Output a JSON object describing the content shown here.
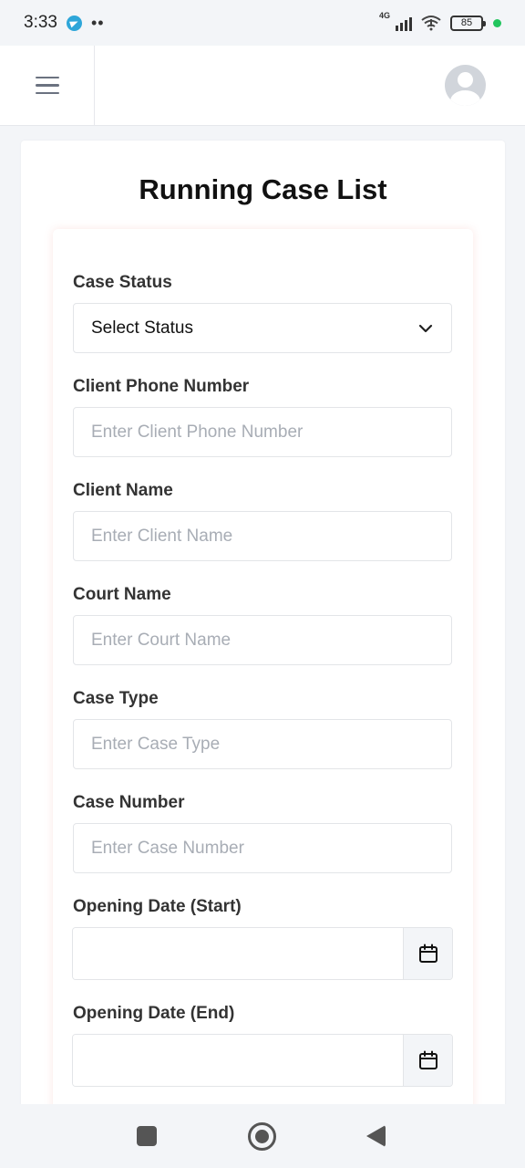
{
  "status_bar": {
    "time": "3:33",
    "network": "4G",
    "battery": "85"
  },
  "page": {
    "title": "Running Case List"
  },
  "form": {
    "case_status": {
      "label": "Case Status",
      "value": "Select Status"
    },
    "client_phone": {
      "label": "Client Phone Number",
      "placeholder": "Enter Client Phone Number"
    },
    "client_name": {
      "label": "Client Name",
      "placeholder": "Enter Client Name"
    },
    "court_name": {
      "label": "Court Name",
      "placeholder": "Enter Court Name"
    },
    "case_type": {
      "label": "Case Type",
      "placeholder": "Enter Case Type"
    },
    "case_number": {
      "label": "Case Number",
      "placeholder": "Enter Case Number"
    },
    "opening_date_start": {
      "label": "Opening Date (Start)",
      "value": ""
    },
    "opening_date_end": {
      "label": "Opening Date (End)",
      "value": ""
    }
  },
  "colors": {
    "accent_shadow": "#ef786e",
    "online": "#22c55e",
    "telegram": "#2ea6d9"
  },
  "icons": [
    "telegram-icon",
    "signal-icon",
    "wifi-icon",
    "battery-icon",
    "menu-icon",
    "avatar-icon",
    "chevron-down-icon",
    "calendar-icon",
    "nav-recents-icon",
    "nav-home-icon",
    "nav-back-icon"
  ]
}
